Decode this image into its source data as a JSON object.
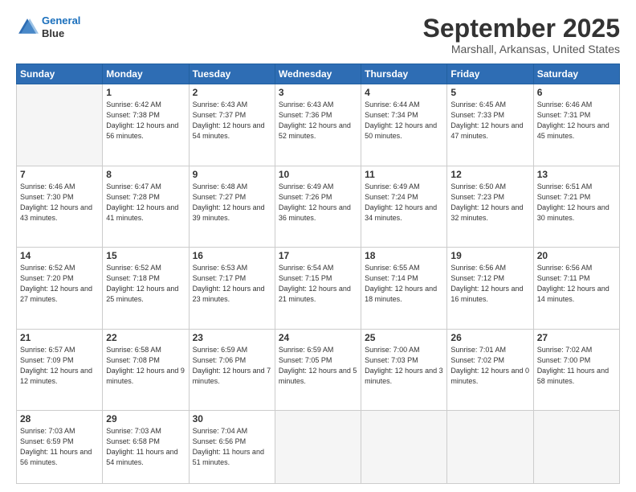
{
  "logo": {
    "line1": "General",
    "line2": "Blue"
  },
  "header": {
    "title": "September 2025",
    "location": "Marshall, Arkansas, United States"
  },
  "weekdays": [
    "Sunday",
    "Monday",
    "Tuesday",
    "Wednesday",
    "Thursday",
    "Friday",
    "Saturday"
  ],
  "weeks": [
    [
      {
        "day": "",
        "empty": true
      },
      {
        "day": "1",
        "sunrise": "Sunrise: 6:42 AM",
        "sunset": "Sunset: 7:38 PM",
        "daylight": "Daylight: 12 hours and 56 minutes."
      },
      {
        "day": "2",
        "sunrise": "Sunrise: 6:43 AM",
        "sunset": "Sunset: 7:37 PM",
        "daylight": "Daylight: 12 hours and 54 minutes."
      },
      {
        "day": "3",
        "sunrise": "Sunrise: 6:43 AM",
        "sunset": "Sunset: 7:36 PM",
        "daylight": "Daylight: 12 hours and 52 minutes."
      },
      {
        "day": "4",
        "sunrise": "Sunrise: 6:44 AM",
        "sunset": "Sunset: 7:34 PM",
        "daylight": "Daylight: 12 hours and 50 minutes."
      },
      {
        "day": "5",
        "sunrise": "Sunrise: 6:45 AM",
        "sunset": "Sunset: 7:33 PM",
        "daylight": "Daylight: 12 hours and 47 minutes."
      },
      {
        "day": "6",
        "sunrise": "Sunrise: 6:46 AM",
        "sunset": "Sunset: 7:31 PM",
        "daylight": "Daylight: 12 hours and 45 minutes."
      }
    ],
    [
      {
        "day": "7",
        "sunrise": "Sunrise: 6:46 AM",
        "sunset": "Sunset: 7:30 PM",
        "daylight": "Daylight: 12 hours and 43 minutes."
      },
      {
        "day": "8",
        "sunrise": "Sunrise: 6:47 AM",
        "sunset": "Sunset: 7:28 PM",
        "daylight": "Daylight: 12 hours and 41 minutes."
      },
      {
        "day": "9",
        "sunrise": "Sunrise: 6:48 AM",
        "sunset": "Sunset: 7:27 PM",
        "daylight": "Daylight: 12 hours and 39 minutes."
      },
      {
        "day": "10",
        "sunrise": "Sunrise: 6:49 AM",
        "sunset": "Sunset: 7:26 PM",
        "daylight": "Daylight: 12 hours and 36 minutes."
      },
      {
        "day": "11",
        "sunrise": "Sunrise: 6:49 AM",
        "sunset": "Sunset: 7:24 PM",
        "daylight": "Daylight: 12 hours and 34 minutes."
      },
      {
        "day": "12",
        "sunrise": "Sunrise: 6:50 AM",
        "sunset": "Sunset: 7:23 PM",
        "daylight": "Daylight: 12 hours and 32 minutes."
      },
      {
        "day": "13",
        "sunrise": "Sunrise: 6:51 AM",
        "sunset": "Sunset: 7:21 PM",
        "daylight": "Daylight: 12 hours and 30 minutes."
      }
    ],
    [
      {
        "day": "14",
        "sunrise": "Sunrise: 6:52 AM",
        "sunset": "Sunset: 7:20 PM",
        "daylight": "Daylight: 12 hours and 27 minutes."
      },
      {
        "day": "15",
        "sunrise": "Sunrise: 6:52 AM",
        "sunset": "Sunset: 7:18 PM",
        "daylight": "Daylight: 12 hours and 25 minutes."
      },
      {
        "day": "16",
        "sunrise": "Sunrise: 6:53 AM",
        "sunset": "Sunset: 7:17 PM",
        "daylight": "Daylight: 12 hours and 23 minutes."
      },
      {
        "day": "17",
        "sunrise": "Sunrise: 6:54 AM",
        "sunset": "Sunset: 7:15 PM",
        "daylight": "Daylight: 12 hours and 21 minutes."
      },
      {
        "day": "18",
        "sunrise": "Sunrise: 6:55 AM",
        "sunset": "Sunset: 7:14 PM",
        "daylight": "Daylight: 12 hours and 18 minutes."
      },
      {
        "day": "19",
        "sunrise": "Sunrise: 6:56 AM",
        "sunset": "Sunset: 7:12 PM",
        "daylight": "Daylight: 12 hours and 16 minutes."
      },
      {
        "day": "20",
        "sunrise": "Sunrise: 6:56 AM",
        "sunset": "Sunset: 7:11 PM",
        "daylight": "Daylight: 12 hours and 14 minutes."
      }
    ],
    [
      {
        "day": "21",
        "sunrise": "Sunrise: 6:57 AM",
        "sunset": "Sunset: 7:09 PM",
        "daylight": "Daylight: 12 hours and 12 minutes."
      },
      {
        "day": "22",
        "sunrise": "Sunrise: 6:58 AM",
        "sunset": "Sunset: 7:08 PM",
        "daylight": "Daylight: 12 hours and 9 minutes."
      },
      {
        "day": "23",
        "sunrise": "Sunrise: 6:59 AM",
        "sunset": "Sunset: 7:06 PM",
        "daylight": "Daylight: 12 hours and 7 minutes."
      },
      {
        "day": "24",
        "sunrise": "Sunrise: 6:59 AM",
        "sunset": "Sunset: 7:05 PM",
        "daylight": "Daylight: 12 hours and 5 minutes."
      },
      {
        "day": "25",
        "sunrise": "Sunrise: 7:00 AM",
        "sunset": "Sunset: 7:03 PM",
        "daylight": "Daylight: 12 hours and 3 minutes."
      },
      {
        "day": "26",
        "sunrise": "Sunrise: 7:01 AM",
        "sunset": "Sunset: 7:02 PM",
        "daylight": "Daylight: 12 hours and 0 minutes."
      },
      {
        "day": "27",
        "sunrise": "Sunrise: 7:02 AM",
        "sunset": "Sunset: 7:00 PM",
        "daylight": "Daylight: 11 hours and 58 minutes."
      }
    ],
    [
      {
        "day": "28",
        "sunrise": "Sunrise: 7:03 AM",
        "sunset": "Sunset: 6:59 PM",
        "daylight": "Daylight: 11 hours and 56 minutes."
      },
      {
        "day": "29",
        "sunrise": "Sunrise: 7:03 AM",
        "sunset": "Sunset: 6:58 PM",
        "daylight": "Daylight: 11 hours and 54 minutes."
      },
      {
        "day": "30",
        "sunrise": "Sunrise: 7:04 AM",
        "sunset": "Sunset: 6:56 PM",
        "daylight": "Daylight: 11 hours and 51 minutes."
      },
      {
        "day": "",
        "empty": true
      },
      {
        "day": "",
        "empty": true
      },
      {
        "day": "",
        "empty": true
      },
      {
        "day": "",
        "empty": true
      }
    ]
  ]
}
